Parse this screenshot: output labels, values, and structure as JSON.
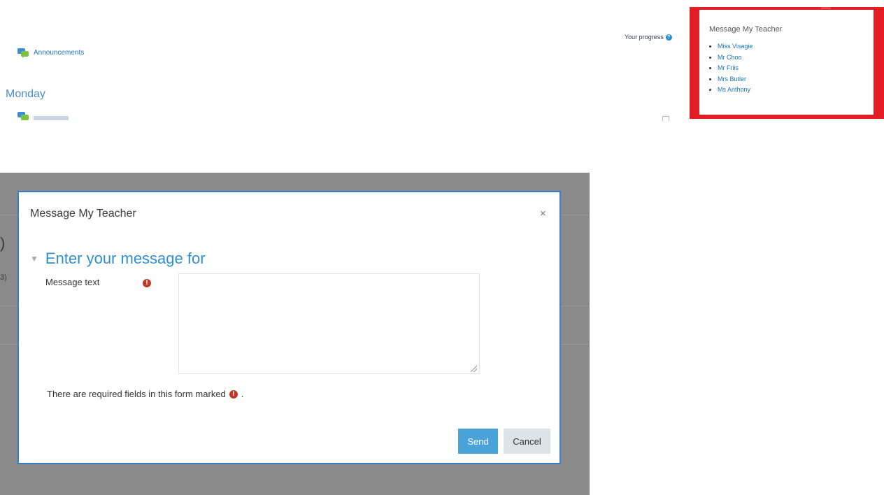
{
  "course": {
    "announcements_label": "Announcements",
    "section_title": "Monday",
    "progress_label": "Your progress",
    "progress_help_glyph": "?"
  },
  "message_block": {
    "title": "Message My Teacher",
    "teachers": [
      "Miss Visagie",
      "Mr Choo",
      "Mr Friis",
      "Mrs Butler",
      "Ms Anthony"
    ]
  },
  "background_fragment": {
    "paren": ")",
    "count": "3)"
  },
  "modal": {
    "title": "Message My Teacher",
    "close_glyph": "×",
    "legend_caret": "▼",
    "legend": "Enter your message for",
    "field_label": "Message text",
    "required_glyph": "!",
    "textarea_value": "",
    "required_note": "There are required fields in this form marked",
    "required_note_end": ".",
    "send_label": "Send",
    "cancel_label": "Cancel"
  },
  "icons": {
    "forum": "forum-icon",
    "help": "help-icon",
    "required": "required-icon",
    "close": "close-icon",
    "caret": "collapse-caret-icon"
  },
  "colors": {
    "accent_blue": "#2f8fd0",
    "link_blue": "#1b75bb",
    "block_red": "#e21d24",
    "required_red": "#c0392b",
    "send_button": "#4aa3d8",
    "overlay_gray": "#8a8a8a"
  }
}
